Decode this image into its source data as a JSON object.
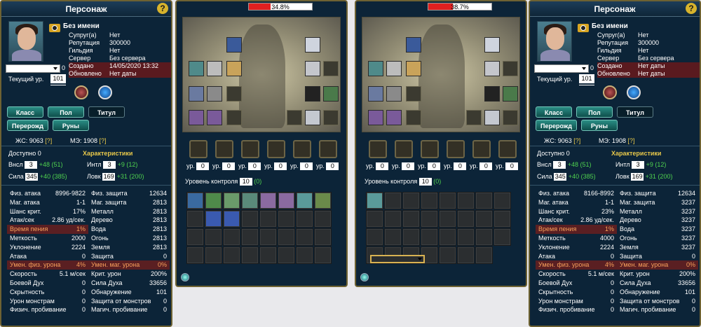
{
  "panels": [
    {
      "title": "Персонаж",
      "help": "?",
      "name": "Без имени",
      "info": [
        {
          "k": "Супруг(а)",
          "v": "Нет"
        },
        {
          "k": "Репутация",
          "v": "300000"
        },
        {
          "k": "Гильдия",
          "v": "Нет"
        },
        {
          "k": "Сервер",
          "v": "Без сервера"
        },
        {
          "k": "Создано",
          "v": "14/05/2020 13:32"
        },
        {
          "k": "Обновлено",
          "v": "Нет даты"
        }
      ],
      "select_num": "0",
      "level_label": "Текущий ур.",
      "level": "101",
      "tabs": [
        "Класс",
        "Пол",
        "Титул",
        "Перерожд",
        "Руны"
      ],
      "js_label": "ЖС:",
      "js": "9063",
      "js_q": "[?]",
      "me_label": "МЭ:",
      "me": "1908",
      "me_q": "[?]",
      "avail_label": "Доступно",
      "avail": "0",
      "chars_label": "Характеристики",
      "attrs": [
        {
          "k": "Внсл",
          "v": "3",
          "b": "+48 (51)"
        },
        {
          "k": "Интл",
          "v": "3",
          "b": "+9 (12)"
        },
        {
          "k": "Сила",
          "v": "345",
          "b": "+40 (385)"
        },
        {
          "k": "Ловк",
          "v": "169",
          "b": "+31 (200)"
        }
      ],
      "rows": [
        [
          [
            "Физ. атака",
            "8996-9822"
          ],
          [
            "Физ. защита",
            "12634"
          ]
        ],
        [
          [
            "Маг. атака",
            "1-1"
          ],
          [
            "Маг. защита",
            "2813"
          ]
        ],
        [
          [
            "Шанс крит.",
            "17%"
          ],
          [
            "Металл",
            "2813"
          ]
        ],
        [
          [
            "Атак/сек",
            "2.86 уд/сек."
          ],
          [
            "Дерево",
            "2813"
          ]
        ],
        [
          [
            "Время пения",
            "1%"
          ],
          [
            "Вода",
            "2813"
          ]
        ],
        [
          [
            "Меткость",
            "2000"
          ],
          [
            "Огонь",
            "2813"
          ]
        ],
        [
          [
            "Уклонение",
            "2224"
          ],
          [
            "Земля",
            "2813"
          ]
        ],
        [
          [
            "Атака",
            "0"
          ],
          [
            "Защита",
            "0"
          ]
        ],
        [
          [
            "Умен. физ. урона",
            "4%"
          ],
          [
            "Умен. маг. урона",
            "0%"
          ]
        ],
        [
          [
            "Скорость",
            "5.1 м/сек"
          ],
          [
            "Крит. урон",
            "200%"
          ]
        ],
        [
          [
            "Боевой Дух",
            "0"
          ],
          [
            "Сила Духа",
            "33656"
          ]
        ],
        [
          [
            "Скрытность",
            "0"
          ],
          [
            "Обнаружение",
            "101"
          ]
        ],
        [
          [
            "Урон монстрам",
            "0"
          ],
          [
            "Защита от монстров",
            "0"
          ]
        ],
        [
          [
            "Физич. пробивание",
            "0"
          ],
          [
            "Магич. пробивание",
            "0"
          ]
        ]
      ]
    },
    {
      "title": "Персонаж",
      "help": "?",
      "name": "Без имени",
      "info": [
        {
          "k": "Супруг(а)",
          "v": "Нет"
        },
        {
          "k": "Репутация",
          "v": "300000"
        },
        {
          "k": "Гильдия",
          "v": "Нет"
        },
        {
          "k": "Сервер",
          "v": "Без сервера"
        },
        {
          "k": "Создано",
          "v": "Нет даты"
        },
        {
          "k": "Обновлено",
          "v": "Нет даты"
        }
      ],
      "select_num": "0",
      "level_label": "Текущий ур.",
      "level": "101",
      "tabs": [
        "Класс",
        "Пол",
        "Титул",
        "Перерожд",
        "Руны"
      ],
      "js_label": "ЖС:",
      "js": "9063",
      "js_q": "[?]",
      "me_label": "МЭ:",
      "me": "1908",
      "me_q": "[?]",
      "avail_label": "Доступно",
      "avail": "0",
      "chars_label": "Характеристики",
      "attrs": [
        {
          "k": "Внсл",
          "v": "3",
          "b": "+48 (51)"
        },
        {
          "k": "Интл",
          "v": "3",
          "b": "+9 (12)"
        },
        {
          "k": "Сила",
          "v": "345",
          "b": "+40 (385)"
        },
        {
          "k": "Ловк",
          "v": "169",
          "b": "+31 (200)"
        }
      ],
      "rows": [
        [
          [
            "Физ. атака",
            "8166-8992"
          ],
          [
            "Физ. защита",
            "12634"
          ]
        ],
        [
          [
            "Маг. атака",
            "1-1"
          ],
          [
            "Маг. защита",
            "3237"
          ]
        ],
        [
          [
            "Шанс крит.",
            "23%"
          ],
          [
            "Металл",
            "3237"
          ]
        ],
        [
          [
            "Атак/сек",
            "2.86 уд/сек."
          ],
          [
            "Дерево",
            "3237"
          ]
        ],
        [
          [
            "Время пения",
            "1%"
          ],
          [
            "Вода",
            "3237"
          ]
        ],
        [
          [
            "Меткость",
            "4000"
          ],
          [
            "Огонь",
            "3237"
          ]
        ],
        [
          [
            "Уклонение",
            "2224"
          ],
          [
            "Земля",
            "3237"
          ]
        ],
        [
          [
            "Атака",
            "0"
          ],
          [
            "Защита",
            "0"
          ]
        ],
        [
          [
            "Умен. физ. урона",
            "4%"
          ],
          [
            "Умен. маг. урона",
            "0%"
          ]
        ],
        [
          [
            "Скорость",
            "5.1 м/сек"
          ],
          [
            "Крит. урон",
            "200%"
          ]
        ],
        [
          [
            "Боевой Дух",
            "0"
          ],
          [
            "Сила Духа",
            "33656"
          ]
        ],
        [
          [
            "Скрытность",
            "0"
          ],
          [
            "Обнаружение",
            "101"
          ]
        ],
        [
          [
            "Урон монстрам",
            "0"
          ],
          [
            "Защита от монстров",
            "0"
          ]
        ],
        [
          [
            "Физич. пробивание",
            "0"
          ],
          [
            "Магич. пробивание",
            "0"
          ]
        ]
      ]
    }
  ],
  "inventories": [
    {
      "progress_text": "34.8%",
      "progress": 0.348,
      "gem_label": "ур.",
      "gem_levels": [
        "0",
        "0",
        "0",
        "0",
        "0",
        "0"
      ],
      "control_label": "Уровень контроля",
      "control": "10",
      "control_bonus": "(0)",
      "filled_cells": 10
    },
    {
      "progress_text": "38.7%",
      "progress": 0.387,
      "gem_label": "ур.",
      "gem_levels": [
        "0",
        "0",
        "0",
        "0",
        "0",
        "0"
      ],
      "control_label": "Уровень контроля",
      "control": "10",
      "control_bonus": "(0)",
      "filled_cells": 1
    }
  ]
}
